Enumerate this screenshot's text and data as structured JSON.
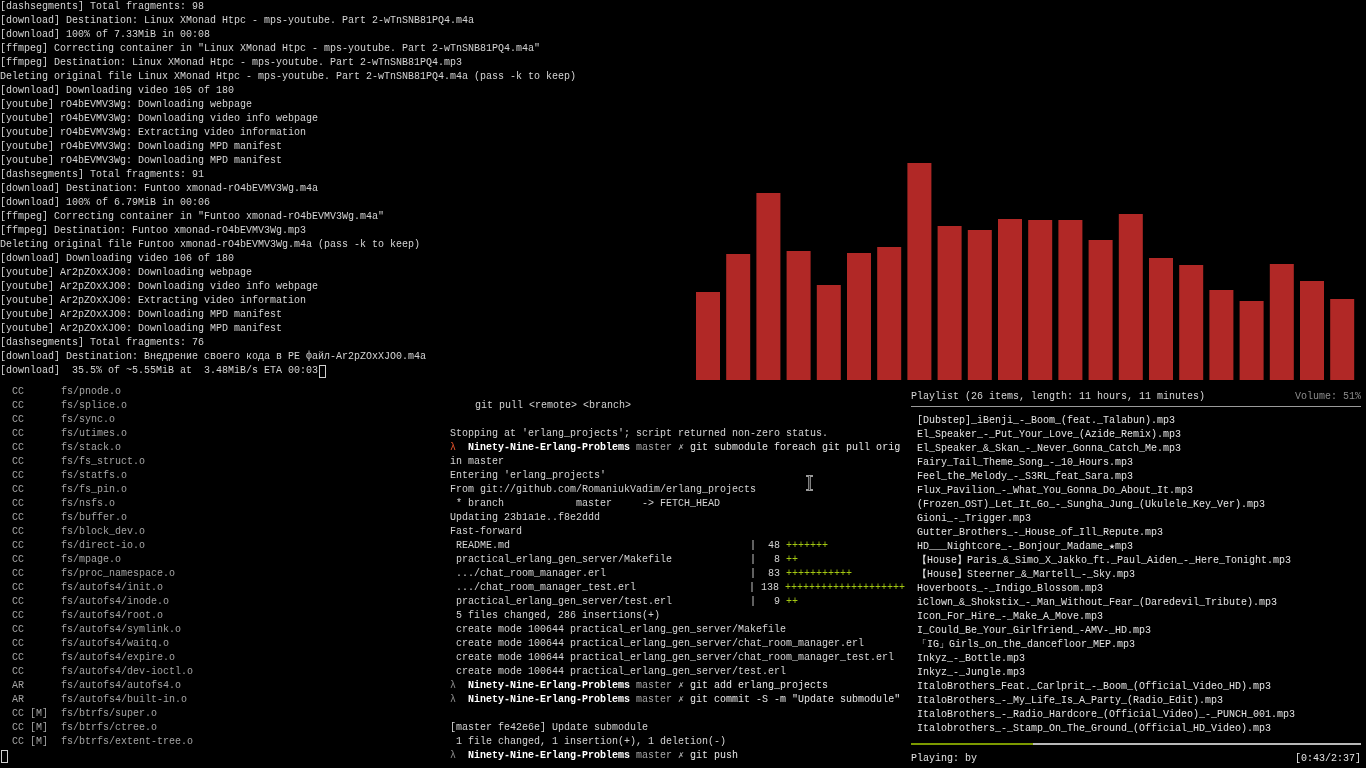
{
  "download_terminal": {
    "lines": [
      {
        "kind": "output",
        "text": "[dashsegments] Total fragments: 98"
      },
      {
        "kind": "output",
        "text": "[download] Destination: Linux XMonad Htpc - mps-youtube. Part 2-wTnSNB81PQ4.m4a"
      },
      {
        "kind": "output",
        "text": "[download] 100% of 7.33MiB in 00:08"
      },
      {
        "kind": "output",
        "text": "[ffmpeg] Correcting container in \"Linux XMonad Htpc - mps-youtube. Part 2-wTnSNB81PQ4.m4a\""
      },
      {
        "kind": "output",
        "text": "[ffmpeg] Destination: Linux XMonad Htpc - mps-youtube. Part 2-wTnSNB81PQ4.mp3"
      },
      {
        "kind": "output",
        "text": "Deleting original file Linux XMonad Htpc - mps-youtube. Part 2-wTnSNB81PQ4.m4a (pass -k to keep)"
      },
      {
        "kind": "output",
        "text": "[download] Downloading video 105 of 180"
      },
      {
        "kind": "output",
        "text": "[youtube] rO4bEVMV3Wg: Downloading webpage"
      },
      {
        "kind": "output",
        "text": "[youtube] rO4bEVMV3Wg: Downloading video info webpage"
      },
      {
        "kind": "output",
        "text": "[youtube] rO4bEVMV3Wg: Extracting video information"
      },
      {
        "kind": "output",
        "text": "[youtube] rO4bEVMV3Wg: Downloading MPD manifest"
      },
      {
        "kind": "output",
        "text": "[youtube] rO4bEVMV3Wg: Downloading MPD manifest"
      },
      {
        "kind": "output",
        "text": "[dashsegments] Total fragments: 91"
      },
      {
        "kind": "output",
        "text": "[download] Destination: Funtoo xmonad-rO4bEVMV3Wg.m4a"
      },
      {
        "kind": "output",
        "text": "[download] 100% of 6.79MiB in 00:06"
      },
      {
        "kind": "output",
        "text": "[ffmpeg] Correcting container in \"Funtoo xmonad-rO4bEVMV3Wg.m4a\""
      },
      {
        "kind": "output",
        "text": "[ffmpeg] Destination: Funtoo xmonad-rO4bEVMV3Wg.mp3"
      },
      {
        "kind": "output",
        "text": "Deleting original file Funtoo xmonad-rO4bEVMV3Wg.m4a (pass -k to keep)"
      },
      {
        "kind": "output",
        "text": "[download] Downloading video 106 of 180"
      },
      {
        "kind": "output",
        "text": "[youtube] Ar2pZOxXJO0: Downloading webpage"
      },
      {
        "kind": "output",
        "text": "[youtube] Ar2pZOxXJO0: Downloading video info webpage"
      },
      {
        "kind": "output",
        "text": "[youtube] Ar2pZOxXJO0: Extracting video information"
      },
      {
        "kind": "output",
        "text": "[youtube] Ar2pZOxXJO0: Downloading MPD manifest"
      },
      {
        "kind": "output",
        "text": "[youtube] Ar2pZOxXJO0: Downloading MPD manifest"
      },
      {
        "kind": "output",
        "text": "[dashsegments] Total fragments: 76"
      },
      {
        "kind": "output",
        "text": "[download] Destination: Внедрение своего кода в PE файл-Ar2pZOxXJO0.m4a"
      },
      {
        "kind": "output",
        "text": "[download]  35.5% of ~5.55MiB at  3.48MiB/s ETA 00:03",
        "cursor": true
      }
    ]
  },
  "build_terminal": {
    "lines": [
      {
        "kind": "build",
        "action": "CC",
        "path": "fs/pnode.o"
      },
      {
        "kind": "build",
        "action": "CC",
        "path": "fs/splice.o"
      },
      {
        "kind": "build",
        "action": "CC",
        "path": "fs/sync.o"
      },
      {
        "kind": "build",
        "action": "CC",
        "path": "fs/utimes.o"
      },
      {
        "kind": "build",
        "action": "CC",
        "path": "fs/stack.o"
      },
      {
        "kind": "build",
        "action": "CC",
        "path": "fs/fs_struct.o"
      },
      {
        "kind": "build",
        "action": "CC",
        "path": "fs/statfs.o"
      },
      {
        "kind": "build",
        "action": "CC",
        "path": "fs/fs_pin.o"
      },
      {
        "kind": "build",
        "action": "CC",
        "path": "fs/nsfs.o"
      },
      {
        "kind": "build",
        "action": "CC",
        "path": "fs/buffer.o"
      },
      {
        "kind": "build",
        "action": "CC",
        "path": "fs/block_dev.o"
      },
      {
        "kind": "build",
        "action": "CC",
        "path": "fs/direct-io.o"
      },
      {
        "kind": "build",
        "action": "CC",
        "path": "fs/mpage.o"
      },
      {
        "kind": "build",
        "action": "CC",
        "path": "fs/proc_namespace.o"
      },
      {
        "kind": "build",
        "action": "CC",
        "path": "fs/autofs4/init.o"
      },
      {
        "kind": "build",
        "action": "CC",
        "path": "fs/autofs4/inode.o"
      },
      {
        "kind": "build",
        "action": "CC",
        "path": "fs/autofs4/root.o"
      },
      {
        "kind": "build",
        "action": "CC",
        "path": "fs/autofs4/symlink.o"
      },
      {
        "kind": "build",
        "action": "CC",
        "path": "fs/autofs4/waitq.o"
      },
      {
        "kind": "build",
        "action": "CC",
        "path": "fs/autofs4/expire.o"
      },
      {
        "kind": "build",
        "action": "CC",
        "path": "fs/autofs4/dev-ioctl.o"
      },
      {
        "kind": "build",
        "action": "AR",
        "path": "fs/autofs4/autofs4.o"
      },
      {
        "kind": "build",
        "action": "AR",
        "path": "fs/autofs4/built-in.o"
      },
      {
        "kind": "build",
        "action": "CC [M]",
        "path": "fs/btrfs/super.o"
      },
      {
        "kind": "build",
        "action": "CC [M]",
        "path": "fs/btrfs/ctree.o"
      },
      {
        "kind": "build",
        "action": "CC [M]",
        "path": "fs/btrfs/extent-tree.o"
      },
      {
        "kind": "blank",
        "cursor": true
      }
    ]
  },
  "git_terminal": {
    "lines": [
      {
        "kind": "hint",
        "text": "git pull <remote> <branch>"
      },
      {
        "kind": "blank"
      },
      {
        "kind": "output",
        "text": "Stopping at 'erlang_projects'; script returned non-zero status."
      },
      {
        "kind": "prompt",
        "symbol": "λ",
        "failed": true,
        "directory": "Ninety-Nine-Erlang-Problems",
        "branch": "master",
        "dirty_mark": "✗",
        "command": "git submodule foreach git pull orig"
      },
      {
        "kind": "output",
        "text": "in master"
      },
      {
        "kind": "output",
        "text": "Entering 'erlang_projects'"
      },
      {
        "kind": "output",
        "text": "From git://github.com/RomaniukVadim/erlang_projects"
      },
      {
        "kind": "detail",
        "text": "* branch            master     -> FETCH_HEAD"
      },
      {
        "kind": "output",
        "text": "Updating 23b1a1e..f8e2ddd"
      },
      {
        "kind": "output",
        "text": "Fast-forward"
      },
      {
        "kind": "diffstat",
        "file": "README.md",
        "separator": "|",
        "count": "48",
        "plus": "+++++++"
      },
      {
        "kind": "diffstat",
        "file": "practical_erlang_gen_server/Makefile",
        "separator": "|",
        "count": "8",
        "plus": "++"
      },
      {
        "kind": "diffstat",
        "file": ".../chat_room_manager.erl",
        "separator": "|",
        "count": "83",
        "plus": "+++++++++++"
      },
      {
        "kind": "diffstat",
        "file": ".../chat_room_manager_test.erl",
        "separator": "|",
        "count": "138",
        "plus": "++++++++++++++++++++"
      },
      {
        "kind": "diffstat",
        "file": "practical_erlang_gen_server/test.erl",
        "separator": "|",
        "count": "9",
        "plus": "++"
      },
      {
        "kind": "detail",
        "text": "5 files changed, 286 insertions(+)"
      },
      {
        "kind": "detail",
        "text": "create mode 100644 practical_erlang_gen_server/Makefile"
      },
      {
        "kind": "detail",
        "text": "create mode 100644 practical_erlang_gen_server/chat_room_manager.erl"
      },
      {
        "kind": "detail",
        "text": "create mode 100644 practical_erlang_gen_server/chat_room_manager_test.erl"
      },
      {
        "kind": "detail",
        "text": "create mode 100644 practical_erlang_gen_server/test.erl"
      },
      {
        "kind": "prompt",
        "symbol": "λ",
        "failed": false,
        "directory": "Ninety-Nine-Erlang-Problems",
        "branch": "master",
        "dirty_mark": "✗",
        "command": "git add erlang_projects"
      },
      {
        "kind": "prompt",
        "symbol": "λ",
        "failed": false,
        "directory": "Ninety-Nine-Erlang-Problems",
        "branch": "master",
        "dirty_mark": "✗",
        "command": "git commit -S -m \"Update submodule\""
      },
      {
        "kind": "blank"
      },
      {
        "kind": "output",
        "text": "[master fe42e6e] Update submodule"
      },
      {
        "kind": "detail",
        "text": "1 file changed, 1 insertion(+), 1 deletion(-)"
      },
      {
        "kind": "prompt",
        "symbol": "λ",
        "failed": false,
        "directory": "Ninety-Nine-Erlang-Problems",
        "branch": "master",
        "dirty_mark": "✗",
        "command": "git push"
      }
    ]
  },
  "music_player": {
    "header": "Playlist (26 items, length: 11 hours, 11 minutes)",
    "volume": "Volume: 51%",
    "playlist": [
      {
        "title": "[Dubstep]_iBenji_-_Boom_(feat._Talabun).mp3"
      },
      {
        "title": "El_Speaker_-_Put_Your_Love_(Azide_Remix).mp3"
      },
      {
        "title": "El_Speaker_&_Skan_-_Never_Gonna_Catch_Me.mp3"
      },
      {
        "title": "Fairy_Tail_Theme_Song_-_10_Hours.mp3"
      },
      {
        "title": "Feel_the_Melody_-_S3RL_feat_Sara.mp3"
      },
      {
        "title": "Flux_Pavilion_-_What_You_Gonna_Do_About_It.mp3"
      },
      {
        "title": "(Frozen_OST)_Let_It_Go_-_Sungha_Jung_(Ukulele_Key_Ver).mp3"
      },
      {
        "title": "Gioni_-_Trigger.mp3"
      },
      {
        "title": "Gutter_Brothers_-_House_of_Ill_Repute.mp3"
      },
      {
        "title": "HD___Nightcore_-_Bonjour_Madame_★mp3"
      },
      {
        "title": "【House】Paris_&_Simo_X_Jakko_ft._Paul_Aiden_-_Here_Tonight.mp3"
      },
      {
        "title": "【House】Steerner_&_Martell_-_Sky.mp3"
      },
      {
        "title": "Hoverboots_-_Indigo_Blossom.mp3"
      },
      {
        "title": "iClown_&_Shokstix_-_Man_Without_Fear_(Daredevil_Tribute).mp3"
      },
      {
        "title": "Icon_For_Hire_-_Make_A_Move.mp3"
      },
      {
        "title": "I_Could_Be_Your_Girlfriend_-AMV-_HD.mp3"
      },
      {
        "title": "「IG」Girls_on_the_dancefloor_MEP.mp3"
      },
      {
        "title": "Inkyz_-_Bottle.mp3"
      },
      {
        "title": "Inkyz_-_Jungle.mp3"
      },
      {
        "title": "ItaloBrothers_Feat._Carlprit_-_Boom_(Official_Video_HD).mp3"
      },
      {
        "title": "ItaloBrothers_-_My_Life_Is_A_Party_(Radio_Edit).mp3"
      },
      {
        "title": "ItaloBrothers_-_Radio_Hardcore_(Official_Video)_-_PUNCH_001.mp3"
      },
      {
        "title": "Italobrothers_-_Stamp_On_The_Ground_(Official_HD_Video).mp3"
      }
    ],
    "progress": {
      "level": 0.27
    },
    "now_playing": "Playing:  by",
    "elapsed": "[0:43/2:37]"
  }
}
